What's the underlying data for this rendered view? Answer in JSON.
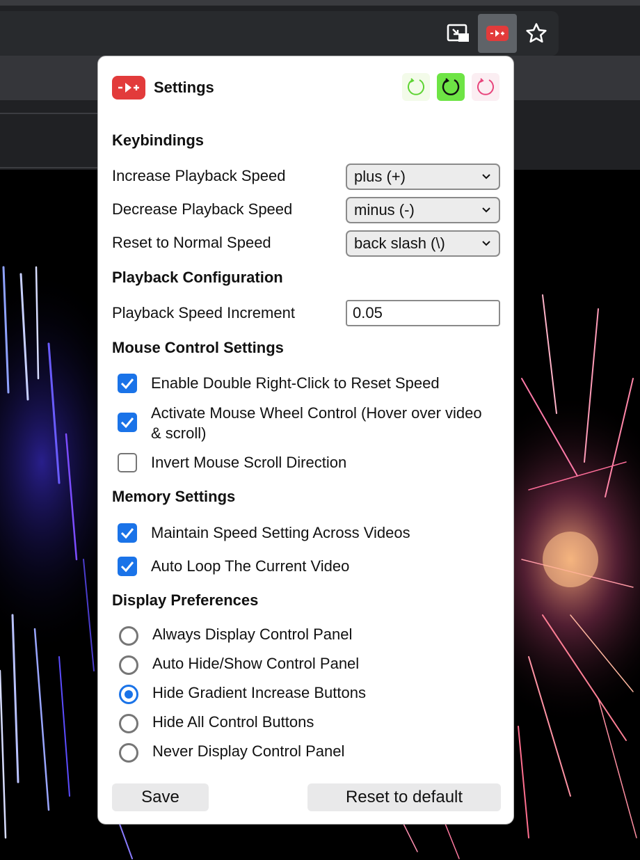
{
  "popup": {
    "title": "Settings",
    "theme_buttons": [
      "light-theme",
      "green-theme",
      "pink-theme"
    ],
    "sections": {
      "keybindings": "Keybindings",
      "playback": "Playback Configuration",
      "mouse": "Mouse Control Settings",
      "memory": "Memory Settings",
      "display": "Display Preferences"
    },
    "keybindings": [
      {
        "label": "Increase Playback Speed",
        "value": "plus (+)"
      },
      {
        "label": "Decrease Playback Speed",
        "value": "minus (-)"
      },
      {
        "label": "Reset to Normal Speed",
        "value": "back slash (\\)"
      }
    ],
    "playback": {
      "label": "Playback Speed Increment",
      "value": "0.05"
    },
    "mouse": [
      {
        "label": "Enable Double Right-Click to Reset Speed",
        "checked": true
      },
      {
        "label": "Activate Mouse Wheel Control (Hover over video & scroll)",
        "checked": true
      },
      {
        "label": "Invert Mouse Scroll Direction",
        "checked": false
      }
    ],
    "memory": [
      {
        "label": "Maintain Speed Setting Across Videos",
        "checked": true
      },
      {
        "label": "Auto Loop The Current Video",
        "checked": true
      }
    ],
    "display": {
      "options": [
        "Always Display Control Panel",
        "Auto Hide/Show Control Panel",
        "Hide Gradient Increase Buttons",
        "Hide All Control Buttons",
        "Never Display Control Panel"
      ],
      "selected": "Hide Gradient Increase Buttons"
    },
    "buttons": {
      "save": "Save",
      "reset": "Reset to default"
    }
  },
  "colors": {
    "accent": "#1a73e8",
    "brand": "#e23b3b",
    "toolbar": "#202124"
  },
  "icons": [
    "picture-in-picture-icon",
    "extension-icon",
    "bookmark-star-icon",
    "chevron-down-icon",
    "checkmark-icon"
  ]
}
